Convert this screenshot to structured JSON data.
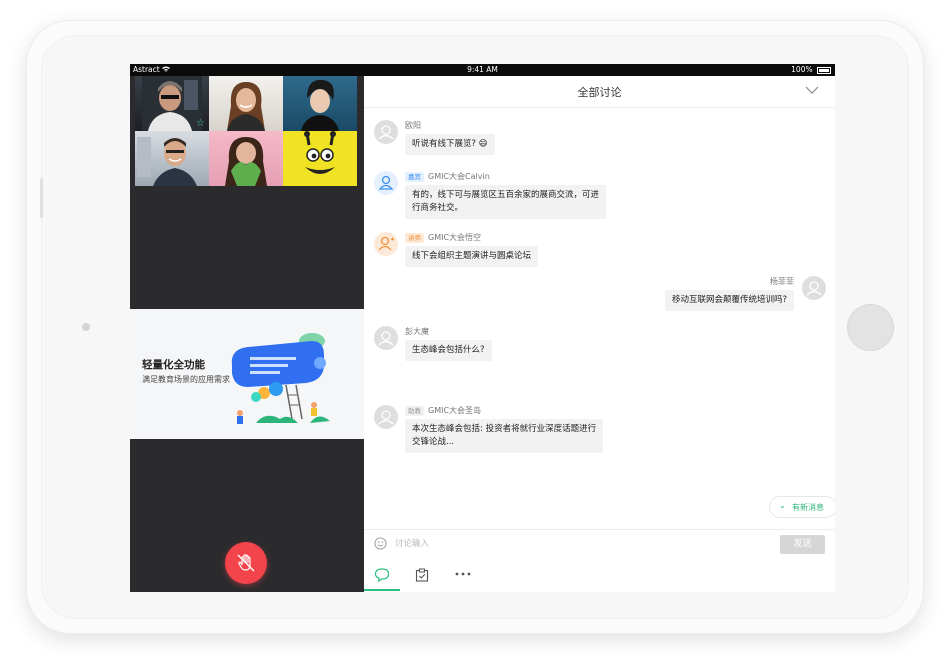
{
  "status_bar": {
    "carrier": "Astract",
    "time": "9:41 AM",
    "battery": "100%"
  },
  "promo": {
    "title": "轻量化全功能",
    "subtitle": "满足教育场景的应用需求"
  },
  "chat": {
    "title": "全部讨论",
    "messages": [
      {
        "name": "欧阳",
        "badge": "",
        "text": "听说有线下展览? 😄",
        "side": "left"
      },
      {
        "name": "GMIC大会Calvin",
        "badge": "嘉宾",
        "text_lines": [
          "有的，线下可与展览区五百余家的展商交流，可进",
          "行商务社交。"
        ],
        "side": "left"
      },
      {
        "name": "GMIC大会悟空",
        "badge": "讲师",
        "text": "线下会组织主题演讲与圆桌论坛",
        "side": "left"
      },
      {
        "name": "杨菲菲",
        "badge": "",
        "text": "移动互联网会颠覆传统培训吗?",
        "side": "right"
      },
      {
        "name": "彭大魔",
        "badge": "",
        "text": "生态峰会包括什么?",
        "side": "left"
      },
      {
        "name": "GMIC大会圣岛",
        "badge": "助教",
        "text_lines": [
          "本次生态峰会包括: 投资者将就行业深度话题进行",
          "交锋论战..."
        ],
        "side": "left"
      }
    ],
    "new_message_label": "有新消息",
    "input_placeholder": "讨论输入",
    "send_label": "发送"
  },
  "colors": {
    "accent": "#2bc07e",
    "mic_button": "#f2444a",
    "badge_guest": "#3b8ef0",
    "badge_lecturer": "#f0913a",
    "badge_assistant": "#999999"
  },
  "icons": [
    "wifi-icon",
    "battery-icon",
    "star-icon",
    "hand-mute-icon",
    "chevron-down-icon",
    "emoji-icon",
    "chat-icon",
    "clipboard-icon",
    "more-icon",
    "user-icon"
  ]
}
